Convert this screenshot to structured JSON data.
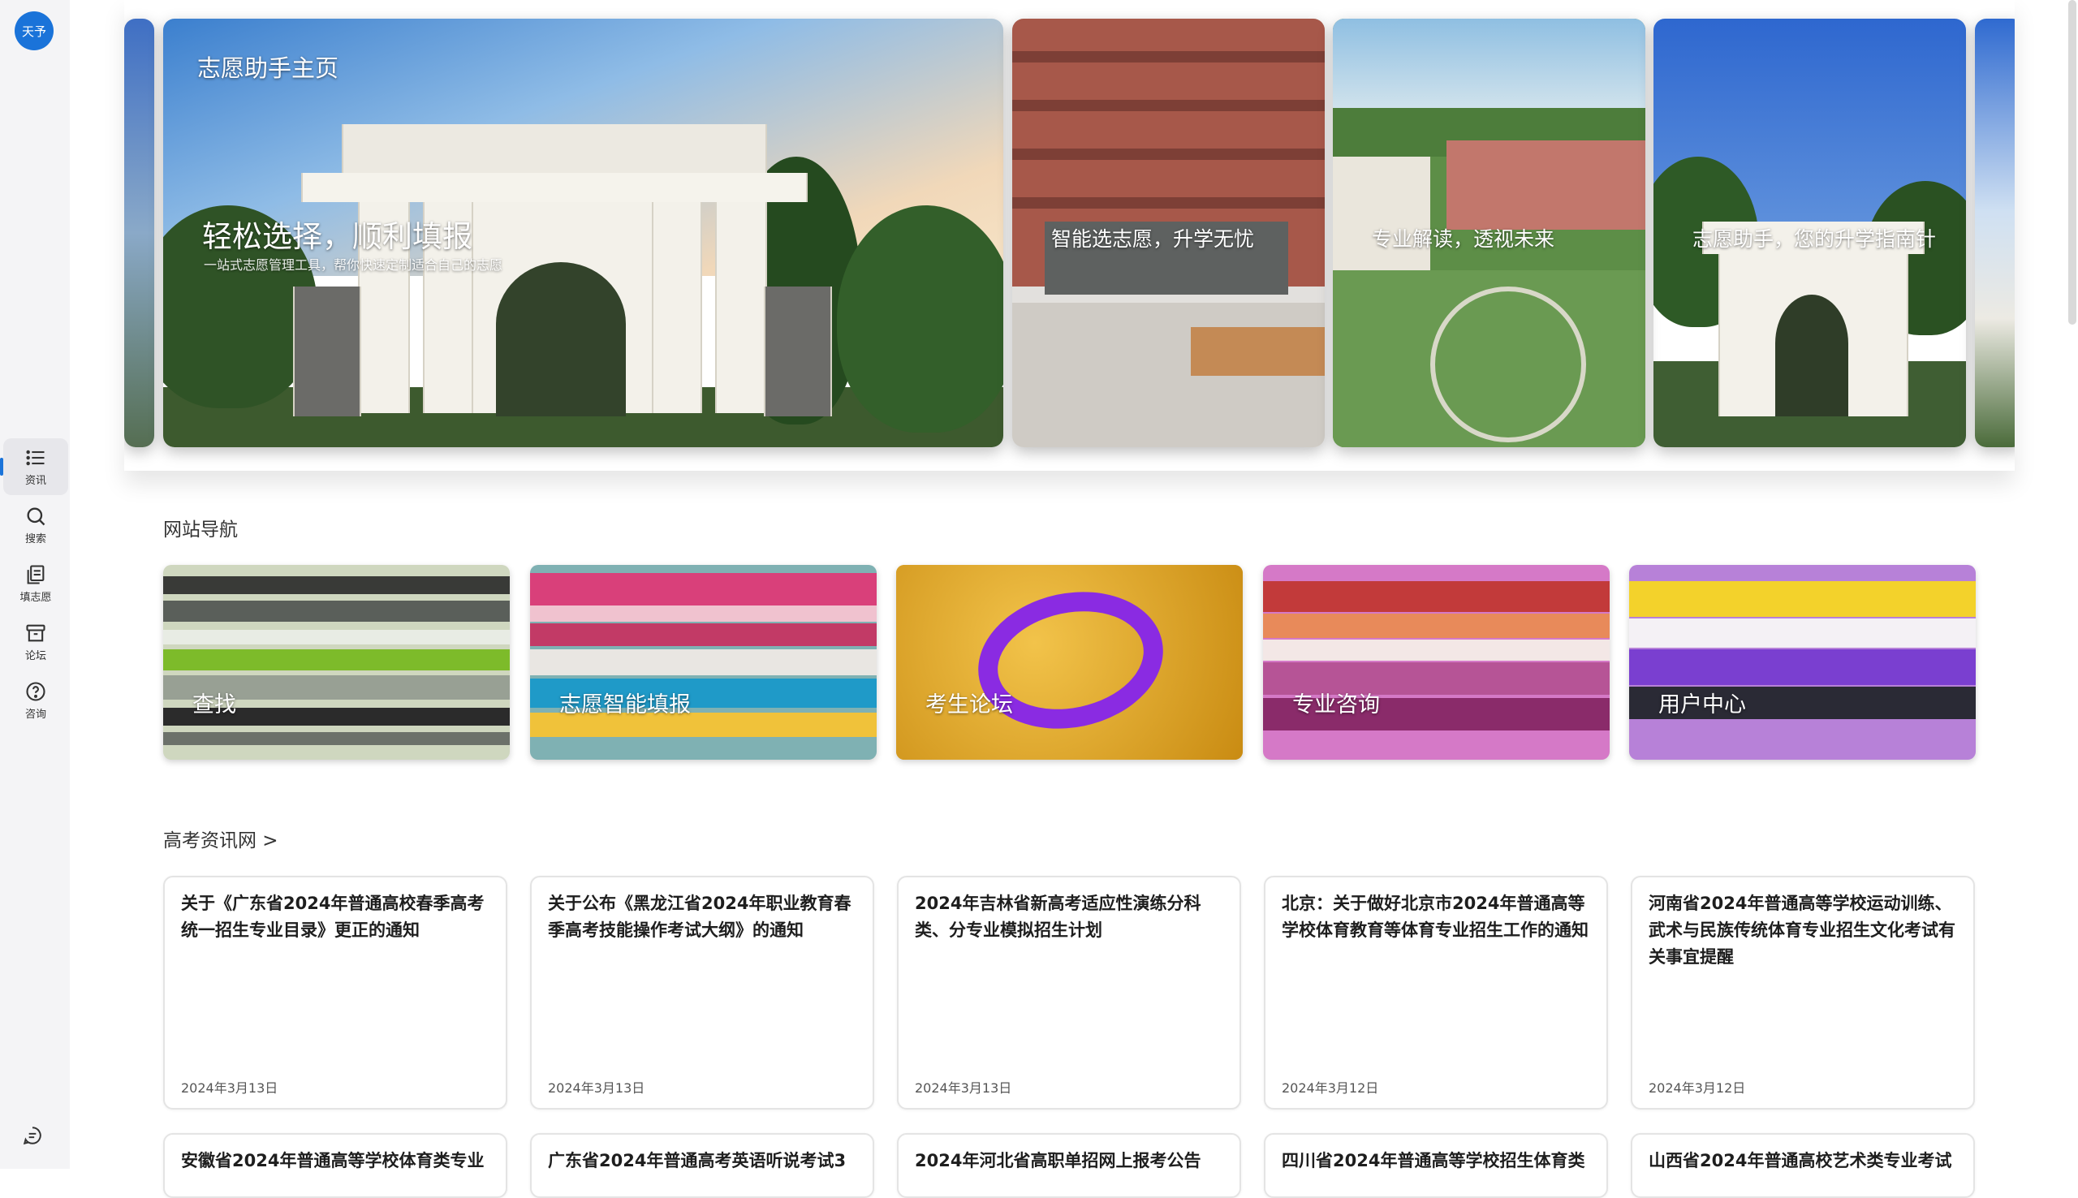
{
  "sidebar": {
    "logo_text": "天予",
    "items": [
      {
        "label": "资讯",
        "icon": "list-icon"
      },
      {
        "label": "搜索",
        "icon": "search-icon"
      },
      {
        "label": "填志愿",
        "icon": "form-icon"
      },
      {
        "label": "论坛",
        "icon": "archive-icon"
      },
      {
        "label": "咨询",
        "icon": "help-icon"
      }
    ],
    "chat_icon": "chat-icon",
    "accent": "#1a73d9"
  },
  "carousel": {
    "header": "志愿助手主页",
    "main_title": "轻松选择，顺利填报",
    "main_subtitle": "一站式志愿管理工具，帮你快速定制适合自己的志愿",
    "slides": [
      {
        "caption": "智能选志愿，升学无忧"
      },
      {
        "caption": "专业解读，透视未来"
      },
      {
        "caption": "志愿助手，您的升学指南针"
      }
    ]
  },
  "site_nav": {
    "title": "网站导航",
    "cards": [
      {
        "label": "查找"
      },
      {
        "label": "志愿智能填报"
      },
      {
        "label": "考生论坛"
      },
      {
        "label": "专业咨询"
      },
      {
        "label": "用户中心"
      }
    ]
  },
  "news": {
    "title": "高考资讯网 >",
    "items": [
      {
        "title": "关于《广东省2024年普通高校春季高考统一招生专业目录》更正的通知",
        "date": "2024年3月13日"
      },
      {
        "title": "关于公布《黑龙江省2024年职业教育春季高考技能操作考试大纲》的通知",
        "date": "2024年3月13日"
      },
      {
        "title": "2024年吉林省新高考适应性演练分科类、分专业模拟招生计划",
        "date": "2024年3月13日"
      },
      {
        "title": "北京：关于做好北京市2024年普通高等学校体育教育等体育专业招生工作的通知",
        "date": "2024年3月12日"
      },
      {
        "title": "河南省2024年普通高等学校运动训练、武术与民族传统体育专业招生文化考试有关事宜提醒",
        "date": "2024年3月12日"
      },
      {
        "title": "安徽省2024年普通高等学校体育类专业"
      },
      {
        "title": "广东省2024年普通高考英语听说考试3"
      },
      {
        "title": "2024年河北省高职单招网上报考公告"
      },
      {
        "title": "四川省2024年普通高等学校招生体育类"
      },
      {
        "title": "山西省2024年普通高校艺术类专业考试"
      }
    ]
  }
}
